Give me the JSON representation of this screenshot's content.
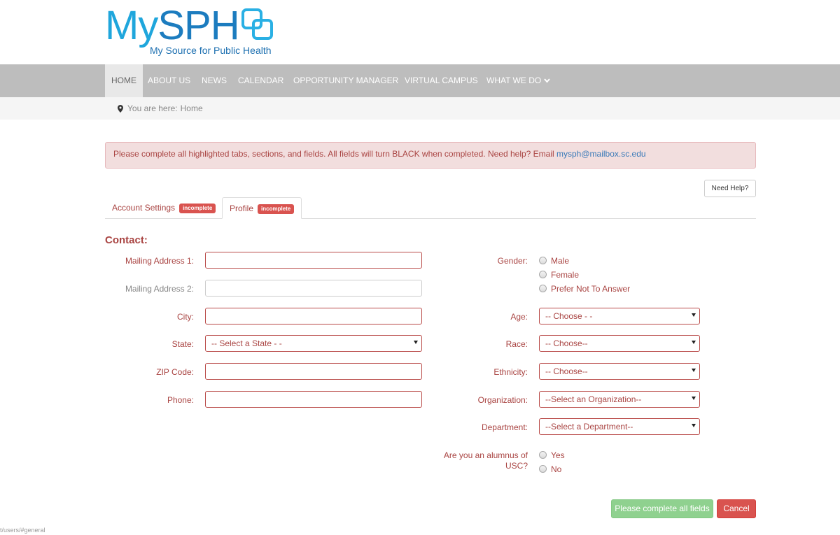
{
  "brand": {
    "name_part1": "My",
    "name_part2": "SPH",
    "tagline_part1": "My Source",
    "tagline_part2": " for Public Health",
    "color_light": "#1fa6dc",
    "color_dark": "#1c7cbf"
  },
  "nav": {
    "items": [
      {
        "label": "HOME",
        "active": true
      },
      {
        "label": "ABOUT US"
      },
      {
        "label": "NEWS"
      },
      {
        "label": "CALENDAR"
      },
      {
        "label": "OPPORTUNITY MANAGER"
      },
      {
        "label": "VIRTUAL CAMPUS"
      },
      {
        "label": "WHAT WE DO",
        "icon": "chevron-down-icon"
      }
    ]
  },
  "breadcrumb": {
    "icon": "map-marker-icon",
    "prefix": "You are here:",
    "current": "Home"
  },
  "alert": {
    "message": "Please complete all highlighted tabs, sections, and fields. All fields will turn BLACK when completed. Need help? Email ",
    "email": "mysph@mailbox.sc.edu",
    "color": "#f2dede"
  },
  "help_button": "Need Help?",
  "tabs": [
    {
      "label": "Account Settings",
      "badge": "incomplete"
    },
    {
      "label": "Profile",
      "badge": "incomplete",
      "active": true
    }
  ],
  "section": {
    "title": "Contact:"
  },
  "left_fields": {
    "mailing1": {
      "label": "Mailing Address 1:",
      "value": ""
    },
    "mailing2": {
      "label": "Mailing Address 2:",
      "value": ""
    },
    "city": {
      "label": "City:",
      "value": ""
    },
    "state": {
      "label": "State:",
      "selected": "-- Select a State - -"
    },
    "zip": {
      "label": "ZIP Code:",
      "value": ""
    },
    "phone": {
      "label": "Phone:",
      "value": ""
    }
  },
  "right_fields": {
    "gender": {
      "label": "Gender:",
      "options": [
        "Male",
        "Female",
        "Prefer Not To Answer"
      ]
    },
    "age": {
      "label": "Age:",
      "selected": "-- Choose - -"
    },
    "race": {
      "label": "Race:",
      "selected": "-- Choose--"
    },
    "ethnicity": {
      "label": "Ethnicity:",
      "selected": "-- Choose--"
    },
    "organization": {
      "label": "Organization:",
      "selected": "--Select an Organization--"
    },
    "department": {
      "label": "Department:",
      "selected": "--Select a Department--"
    },
    "alumnus": {
      "label_line1": "Are you an alumnus of",
      "label_line2": "USC?",
      "options": [
        "Yes",
        "No"
      ]
    }
  },
  "actions": {
    "submit": "Please complete all fields",
    "cancel": "Cancel"
  },
  "status_url": "t/users/#general",
  "colors": {
    "error_text": "#a94442",
    "error_border": "#b94a48",
    "badge": "#d9534f",
    "submit_bg": "#8fd18f",
    "cancel_bg": "#d9534f",
    "nav_bg": "#bdbdbd"
  }
}
